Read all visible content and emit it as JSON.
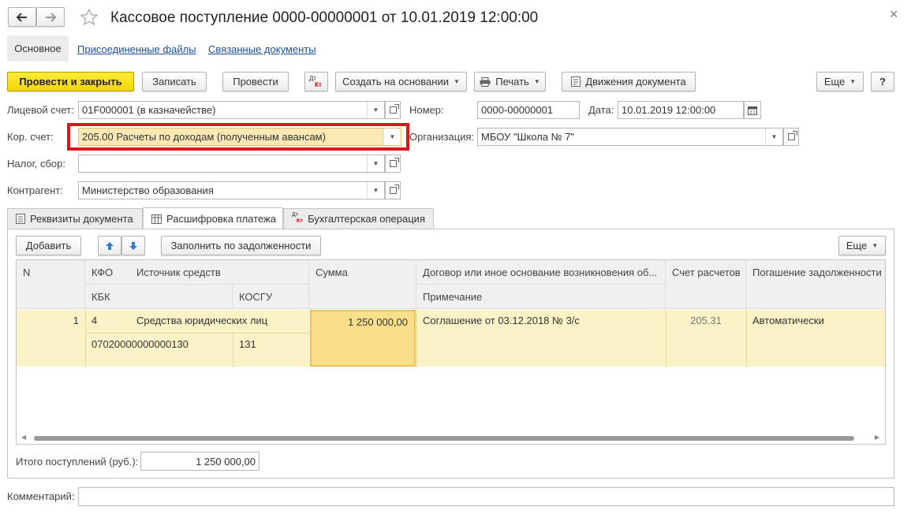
{
  "window": {
    "title": "Кассовое поступление 0000-00000001 от 10.01.2019 12:00:00",
    "close_glyph": "×"
  },
  "nav_tabs": [
    {
      "label": "Основное"
    },
    {
      "label": "Присоединенные файлы"
    },
    {
      "label": "Связанные документы"
    }
  ],
  "toolbar": {
    "post_close": "Провести и закрыть",
    "save": "Записать",
    "post": "Провести",
    "dt": "Дт",
    "kt": "Кт",
    "create_based": "Создать на основании",
    "print": "Печать",
    "movements": "Движения документа",
    "more": "Еще",
    "help": "?"
  },
  "form": {
    "account_label": "Лицевой счет:",
    "account_value": "01F000001 (в казначействе)",
    "number_label": "Номер:",
    "number_value": "0000-00000001",
    "date_label": "Дата:",
    "date_value": "10.01.2019 12:00:00",
    "cor_account_label": "Кор. счет:",
    "cor_account_value": "205.00 Расчеты по доходам (полученным авансам)",
    "org_label": "Организация:",
    "org_value": "МБОУ \"Школа № 7\"",
    "tax_label": "Налог, сбор:",
    "tax_value": "",
    "contractor_label": "Контрагент:",
    "contractor_value": "Министерство образования"
  },
  "content_tabs": [
    {
      "label": "Реквизиты документа"
    },
    {
      "label": "Расшифровка платежа"
    },
    {
      "label": "Бухгалтерская операция"
    }
  ],
  "table_toolbar": {
    "add": "Добавить",
    "fill_debt": "Заполнить по задолженности",
    "more": "Еще"
  },
  "table": {
    "headers": {
      "n": "N",
      "kfo": "КФО",
      "source": "Источник средств",
      "kbk": "КБК",
      "kosgu": "КОСГУ",
      "sum": "Сумма",
      "contract": "Договор или иное основание возникновения об...",
      "note": "Примечание",
      "account": "Счет расчетов",
      "repayment": "Погашение задолженности"
    },
    "rows": [
      {
        "n": "1",
        "kfo": "4",
        "source": "Средства юридических лиц",
        "kbk": "07020000000000130",
        "kosgu": "131",
        "sum": "1 250 000,00",
        "contract": "Соглашение от 03.12.2018 № 3/с",
        "note": "",
        "account": "205.31",
        "repayment": "Автоматически"
      }
    ]
  },
  "totals": {
    "label": "Итого поступлений (руб.):",
    "value": "1 250 000,00"
  },
  "comment": {
    "label": "Комментарий:",
    "value": ""
  },
  "colors": {
    "highlight_row": "#fbf2c8",
    "selected_cell": "#f9df8a",
    "red_frame": "#e0141c",
    "primary_button": "#f4d600",
    "link": "#1a4fa0"
  }
}
